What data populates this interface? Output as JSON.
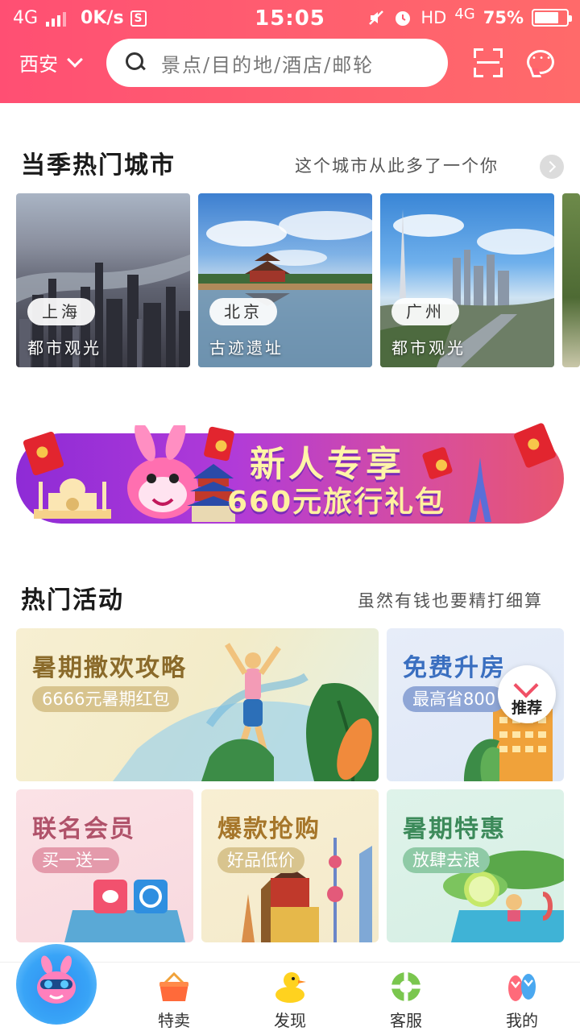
{
  "status_bar": {
    "network": "4G",
    "speed": "0K/s",
    "time": "15:05",
    "hd_label": "HD",
    "network_right": "4G",
    "battery": "75%",
    "battery_level": 0.75
  },
  "header": {
    "city": "西安",
    "search_placeholder": "景点/目的地/酒店/邮轮"
  },
  "hot_cities": {
    "title": "当季热门城市",
    "subtitle": "这个城市从此多了一个你",
    "cities": [
      {
        "name": "上海",
        "theme": "都市观光"
      },
      {
        "name": "北京",
        "theme": "古迹遗址"
      },
      {
        "name": "广州",
        "theme": "都市观光"
      }
    ]
  },
  "banner": {
    "title": "新人专享",
    "subtitle": "660元旅行礼包"
  },
  "activities": {
    "title": "热门活动",
    "subtitle": "虽然有钱也要精打细算",
    "items": [
      {
        "title": "暑期撒欢攻略",
        "tag": "6666元暑期红包"
      },
      {
        "title": "免费升房",
        "tag": "最高省800"
      },
      {
        "title": "联名会员",
        "tag": "买一送一"
      },
      {
        "title": "爆款抢购",
        "tag": "好品低价"
      },
      {
        "title": "暑期特惠",
        "tag": "放肆去浪"
      }
    ],
    "recommend_label": "推荐"
  },
  "tabbar": {
    "tabs": [
      {
        "label": "特卖"
      },
      {
        "label": "发现"
      },
      {
        "label": "客服"
      },
      {
        "label": "我的"
      }
    ]
  },
  "colors": {
    "header_start": "#ff4f73",
    "header_end": "#ff6a6a",
    "accent": "#f05066"
  }
}
